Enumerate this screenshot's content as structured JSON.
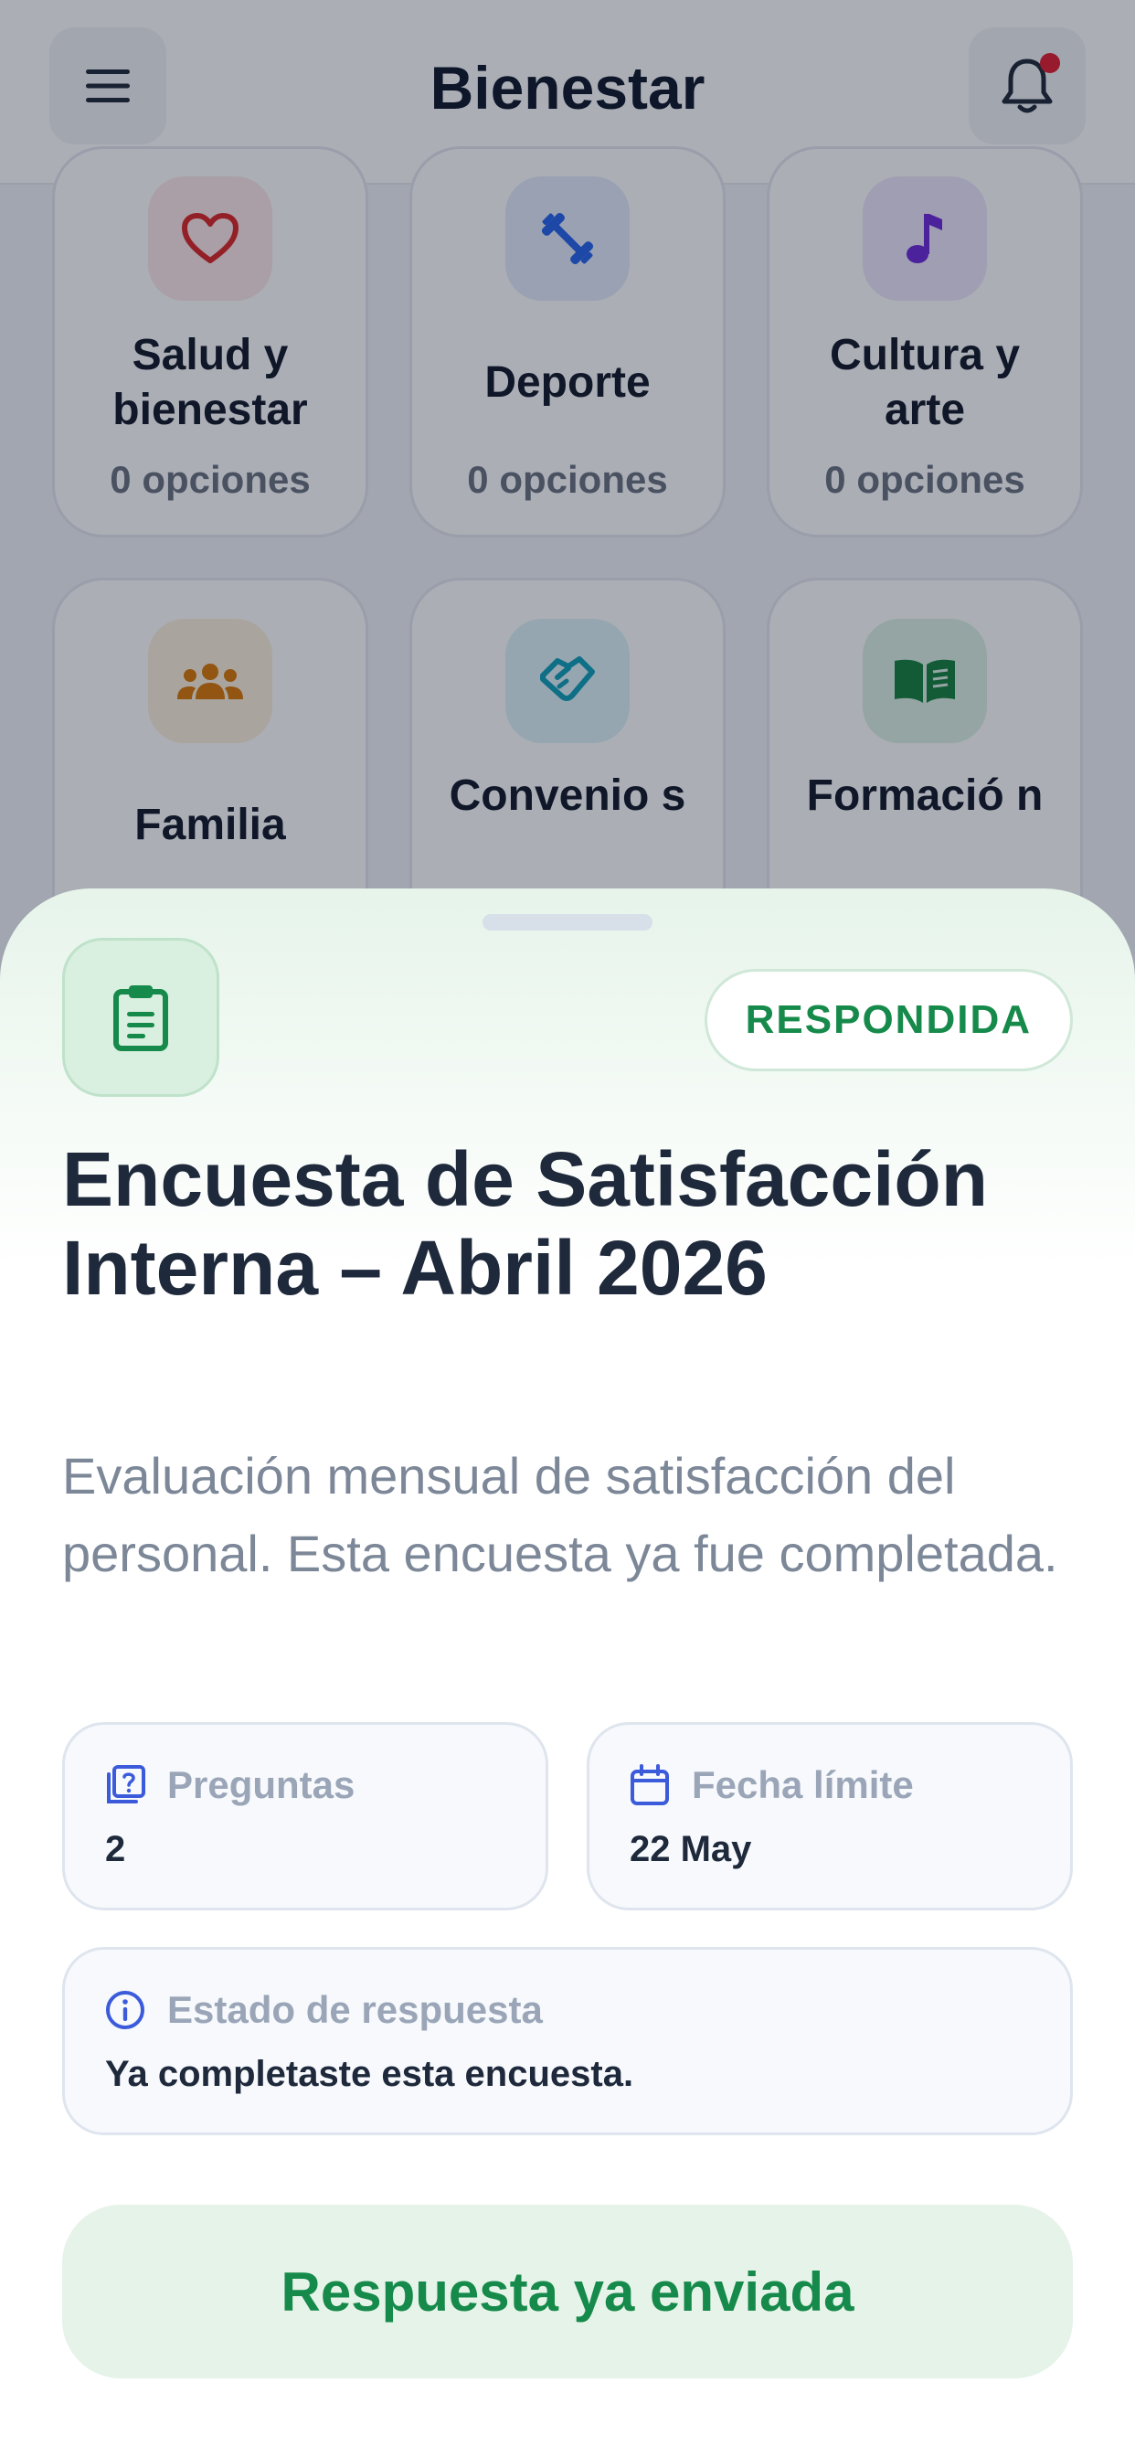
{
  "header": {
    "title": "Bienestar",
    "menu_icon": "menu-icon",
    "bell_icon": "bell-icon"
  },
  "categories": [
    {
      "name": "Salud y bienestar",
      "options": "0 opciones",
      "icon": "heart-icon",
      "color": "#dc2626",
      "tile": "#fde8e8"
    },
    {
      "name": "Deporte",
      "options": "0 opciones",
      "icon": "dumbbell-icon",
      "color": "#2563eb",
      "tile": "#e4ebfb"
    },
    {
      "name": "Cultura y arte",
      "options": "0 opciones",
      "icon": "music-note-icon",
      "color": "#6d28d9",
      "tile": "#ede7fb"
    },
    {
      "name": "Familia",
      "options": "",
      "icon": "group-icon",
      "color": "#d97706",
      "tile": "#fdf0dc"
    },
    {
      "name": "Convenio s",
      "options": "",
      "icon": "handshake-icon",
      "color": "#0f9fb8",
      "tile": "#dff3f7"
    },
    {
      "name": "Formació n",
      "options": "",
      "icon": "book-icon",
      "color": "#15803d",
      "tile": "#dcf1e3"
    }
  ],
  "sheet": {
    "icon": "clipboard-icon",
    "status_badge": "RESPONDIDA",
    "title": "Encuesta de Satisfacción Interna – Abril 2026",
    "description": "Evaluación mensual de satisfacción del personal. Esta encuesta ya fue completada.",
    "questions": {
      "label": "Preguntas",
      "value": "2",
      "icon": "question-icon"
    },
    "deadline": {
      "label": "Fecha límite",
      "value": "22 May",
      "icon": "calendar-icon"
    },
    "response_status": {
      "label": "Estado de respuesta",
      "value": "Ya completaste esta encuesta.",
      "icon": "info-icon"
    },
    "action_label": "Respuesta ya enviada"
  },
  "colors": {
    "accent_green": "#168a4a",
    "title_dark": "#1e293b",
    "notification_dot": "#e11d2f"
  }
}
